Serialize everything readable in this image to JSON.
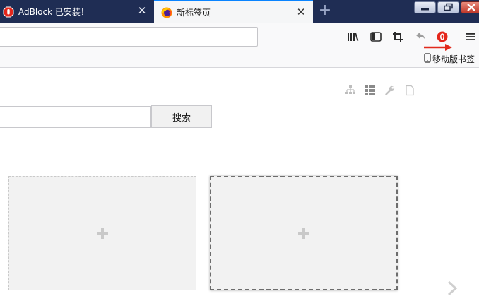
{
  "tabs": [
    {
      "label": "AdBlock 已安装！",
      "icon": "adblock-stop-icon",
      "active": false
    },
    {
      "label": "新标签页",
      "icon": "firefox-icon",
      "active": true
    }
  ],
  "toolbar": {
    "icons": [
      "library-icon",
      "sidebar-icon",
      "screenshot-crop-icon",
      "undo-arrow-icon",
      "opera-o-icon",
      "menu-icon"
    ],
    "bookmark_item": "移动版书签"
  },
  "newtab": {
    "controls": [
      "sitemap-icon",
      "grid-icon",
      "wrench-icon",
      "page-icon"
    ],
    "search": {
      "value": "",
      "button_label": "搜索"
    },
    "tiles": [
      {
        "empty": true
      },
      {
        "empty": true
      }
    ]
  },
  "colors": {
    "tabstrip_bg": "#1f2d54",
    "active_tab_bg": "#f5f6f7",
    "adblock_red": "#e5261b",
    "annotation_arrow": "#e12a1c"
  }
}
